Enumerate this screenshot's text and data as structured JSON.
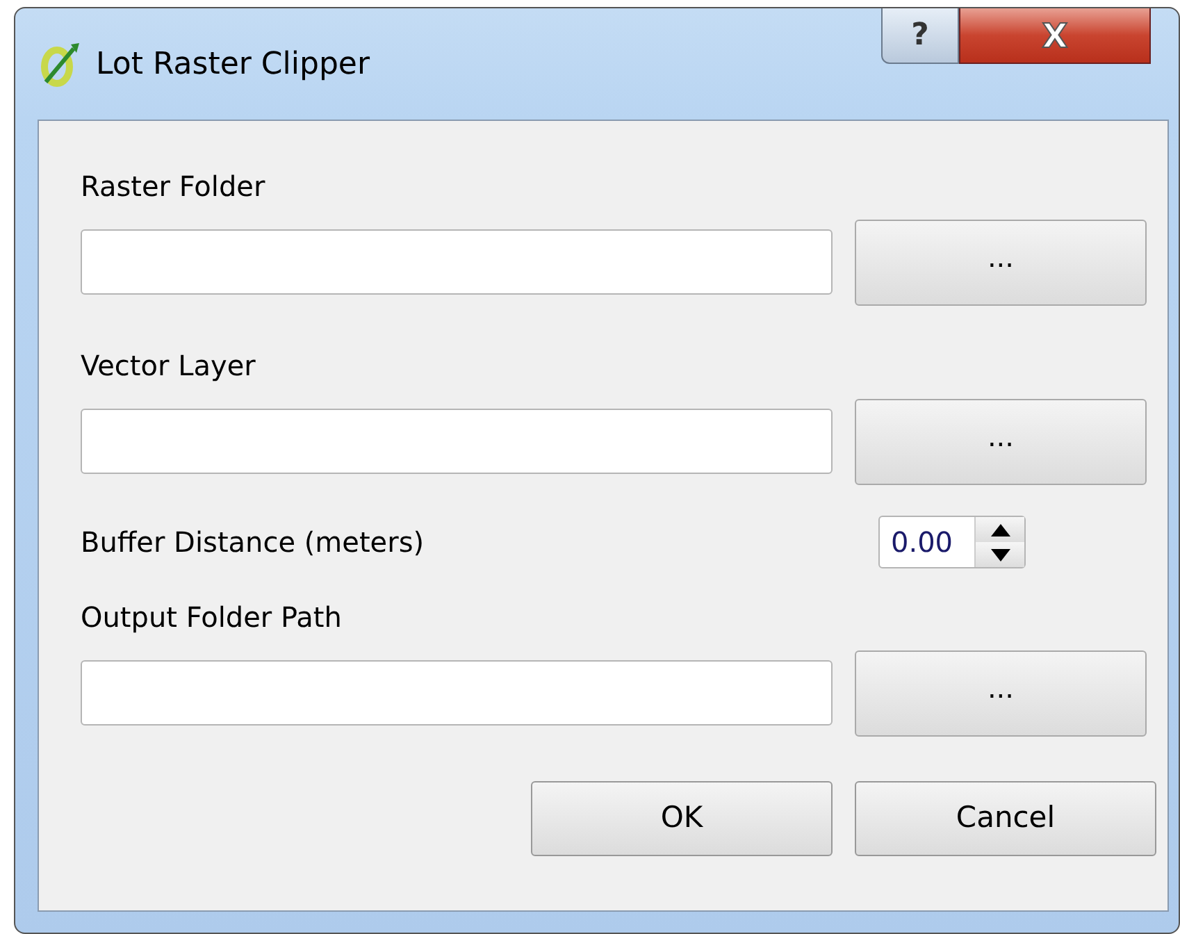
{
  "window": {
    "title": "Lot Raster Clipper",
    "help_button": "?",
    "close_button": "X"
  },
  "rows": [
    {
      "kind": "path",
      "label": "Raster Folder",
      "browse": "..."
    },
    {
      "kind": "path",
      "label": "Vector Layer",
      "browse": "..."
    },
    {
      "kind": "number",
      "label": "Buffer Distance (meters)",
      "value": "0.00"
    },
    {
      "kind": "path",
      "label": "Output Folder Path",
      "browse": "..."
    }
  ],
  "buttons": [
    "OK",
    "Cancel"
  ]
}
